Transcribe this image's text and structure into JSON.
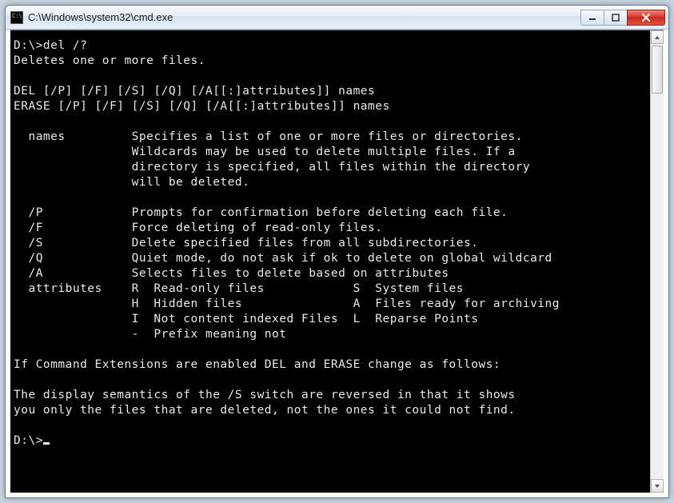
{
  "titlebar": {
    "title": "C:\\Windows\\system32\\cmd.exe",
    "min_tooltip": "Minimize",
    "max_tooltip": "Maximize",
    "close_tooltip": "Close"
  },
  "console": {
    "lines": [
      "D:\\>del /?",
      "Deletes one or more files.",
      "",
      "DEL [/P] [/F] [/S] [/Q] [/A[[:]attributes]] names",
      "ERASE [/P] [/F] [/S] [/Q] [/A[[:]attributes]] names",
      "",
      "  names         Specifies a list of one or more files or directories.",
      "                Wildcards may be used to delete multiple files. If a",
      "                directory is specified, all files within the directory",
      "                will be deleted.",
      "",
      "  /P            Prompts for confirmation before deleting each file.",
      "  /F            Force deleting of read-only files.",
      "  /S            Delete specified files from all subdirectories.",
      "  /Q            Quiet mode, do not ask if ok to delete on global wildcard",
      "  /A            Selects files to delete based on attributes",
      "  attributes    R  Read-only files            S  System files",
      "                H  Hidden files               A  Files ready for archiving",
      "                I  Not content indexed Files  L  Reparse Points",
      "                -  Prefix meaning not",
      "",
      "If Command Extensions are enabled DEL and ERASE change as follows:",
      "",
      "The display semantics of the /S switch are reversed in that it shows",
      "you only the files that are deleted, not the ones it could not find.",
      "",
      "D:\\>"
    ]
  }
}
